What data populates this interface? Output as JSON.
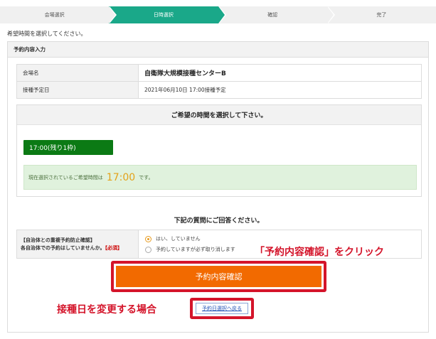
{
  "steps": [
    {
      "label": "会場選択",
      "active": false
    },
    {
      "label": "日時選択",
      "active": true
    },
    {
      "label": "確認",
      "active": false
    },
    {
      "label": "完了",
      "active": false
    }
  ],
  "instruction": "希望時間を選択してください。",
  "panel": {
    "title": "予約内容入力",
    "rows": [
      {
        "label": "会場名",
        "value": "自衛隊大規模接種センターB"
      },
      {
        "label": "接種予定日",
        "value": "2021年06月10日 17:00接種予定"
      }
    ]
  },
  "time_select": {
    "heading": "ご希望の時間を選択して下さい。",
    "slot_label": "17:00(残り1枠)",
    "selected_prefix": "現在選択されているご希望時間は",
    "selected_time": "17:00",
    "selected_suffix": "です。"
  },
  "question": {
    "title": "下記の質問にご回答ください。",
    "label_line1": "【自治体との重複予約防止確認】",
    "label_line2": "各自治体での予約はしていませんか。",
    "required": "【必須】",
    "options": [
      {
        "label": "はい、していません",
        "checked": true
      },
      {
        "label": "予約していますが必ず取り消します",
        "checked": false
      }
    ]
  },
  "submit_label": "予約内容確認",
  "back_label": "予約日選択へ戻る",
  "annotations": {
    "click": "「予約内容確認」をクリック",
    "change": "接種日を変更する場合"
  },
  "colors": {
    "active_step": "#1aa889",
    "slot_button": "#0b7a14",
    "submit": "#f26a00",
    "highlight_border": "#d4142a",
    "selected_time": "#e3a21a"
  }
}
